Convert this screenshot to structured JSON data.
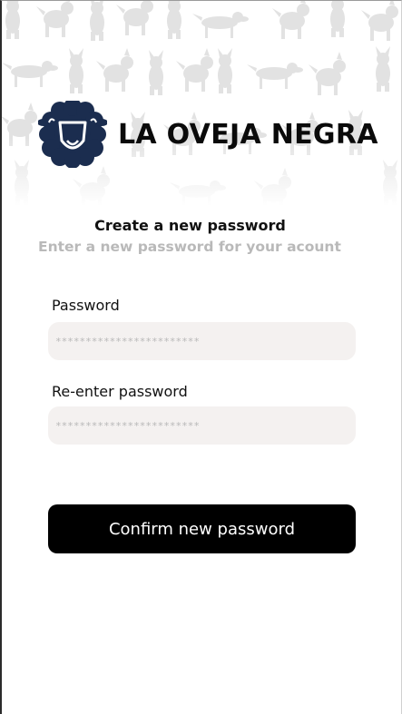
{
  "brand": {
    "name": "LA OVEJA NEGRA"
  },
  "header": {
    "title": "Create a new password",
    "subtitle": "Enter a new password for your acount"
  },
  "form": {
    "password_label": "Password",
    "password_placeholder": "************************",
    "reenter_label": "Re-enter password",
    "reenter_placeholder": "************************",
    "confirm_button": "Confirm new password"
  },
  "colors": {
    "brand_navy": "#1b2d4f",
    "field_bg": "#f4f1f0",
    "button_bg": "#000000",
    "subtitle": "#b9b9b9"
  },
  "icons": [
    "dog-silhouette-pattern",
    "sheep-logo-icon"
  ]
}
